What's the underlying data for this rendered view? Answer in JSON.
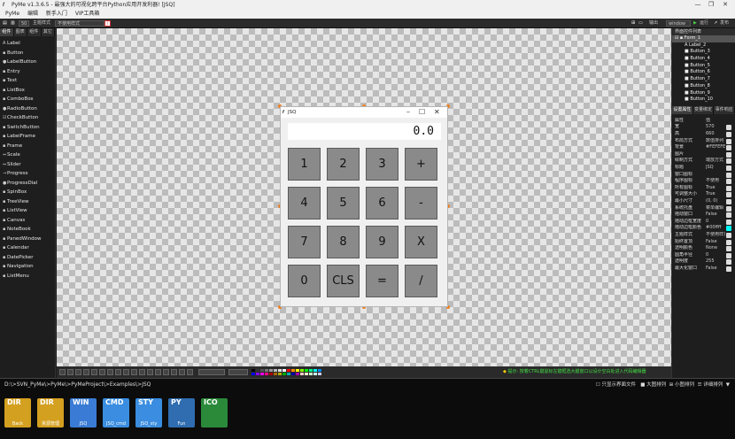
{
  "window": {
    "title": "PyMe v1.3.6.5 - 最强大的可视化跨平台Python应用开发利器! [JSQ]",
    "controls": [
      "—",
      "❐",
      "✕"
    ]
  },
  "menu": [
    "PyMe",
    "编辑",
    "新手入门",
    "VIP工具箱"
  ],
  "toolbar": {
    "zoom": "50",
    "theme_label": "主题样式",
    "style_select": "不使用样式",
    "output": "输出",
    "platform": "window",
    "run": "运行",
    "publish": "发布"
  },
  "palette": {
    "tabs": [
      "组件",
      "图表",
      "组件",
      "其它"
    ],
    "items": [
      {
        "icon": "A",
        "label": "Label"
      },
      {
        "icon": "▪",
        "label": "Button"
      },
      {
        "icon": "●",
        "label": "LabelButton"
      },
      {
        "icon": "▪",
        "label": "Entry"
      },
      {
        "icon": "▪",
        "label": "Text"
      },
      {
        "icon": "▪",
        "label": "ListBox"
      },
      {
        "icon": "▪",
        "label": "ComboBox"
      },
      {
        "icon": "●",
        "label": "RadioButton"
      },
      {
        "icon": "☑",
        "label": "CheckButton"
      },
      {
        "icon": "▪",
        "label": "SwitchButton"
      },
      {
        "icon": "▪",
        "label": "LabelFrame"
      },
      {
        "icon": "▪",
        "label": "Frame"
      },
      {
        "icon": "⇔",
        "label": "Scale"
      },
      {
        "icon": "⇔",
        "label": "Slider"
      },
      {
        "icon": "→",
        "label": "Progress"
      },
      {
        "icon": "●",
        "label": "ProgressDial"
      },
      {
        "icon": "▪",
        "label": "SpinBox"
      },
      {
        "icon": "▪",
        "label": "TreeView"
      },
      {
        "icon": "▪",
        "label": "ListView"
      },
      {
        "icon": "▪",
        "label": "Canvas"
      },
      {
        "icon": "▪",
        "label": "NoteBook"
      },
      {
        "icon": "▪",
        "label": "PanedWindow"
      },
      {
        "icon": "▪",
        "label": "Calendar"
      },
      {
        "icon": "▪",
        "label": "DatePicker"
      },
      {
        "icon": "▪",
        "label": "Navigation"
      },
      {
        "icon": "▪",
        "label": "ListMenu"
      }
    ]
  },
  "form": {
    "title": "JSQ",
    "display": "0.0",
    "keys": [
      "1",
      "2",
      "3",
      "+",
      "4",
      "5",
      "6",
      "-",
      "7",
      "8",
      "9",
      "X",
      "0",
      "CLS",
      "=",
      "/"
    ]
  },
  "tree": {
    "header": "界面控件列表",
    "root": "Form_1",
    "items": [
      "Label_2",
      "Button_3",
      "Button_4",
      "Button_5",
      "Button_6",
      "Button_7",
      "Button_8",
      "Button_9",
      "Button_10"
    ]
  },
  "props": {
    "tabs": [
      "设置属性",
      "变量绑定",
      "事件响应"
    ],
    "header": {
      "key": "属性",
      "value": "值"
    },
    "rows": [
      {
        "k": "宽",
        "v": "570"
      },
      {
        "k": "高",
        "v": "660"
      },
      {
        "k": "布局方式",
        "v": "数值排列"
      },
      {
        "k": "背景",
        "v": "#FEFEFE"
      },
      {
        "k": "图片",
        "v": ""
      },
      {
        "k": "绘制方式",
        "v": "端放方式"
      },
      {
        "k": "标题",
        "v": "JSQ"
      },
      {
        "k": "窗口图标",
        "v": ""
      },
      {
        "k": "程序图标",
        "v": "不使用"
      },
      {
        "k": "所有图标",
        "v": "True"
      },
      {
        "k": "可调整大小",
        "v": "True"
      },
      {
        "k": "最小尺寸",
        "v": "(0, 0)"
      },
      {
        "k": "系统托盘",
        "v": "菜单编辑"
      },
      {
        "k": "拖动窗口",
        "v": "False"
      },
      {
        "k": "拖动边框宽度",
        "v": "0"
      },
      {
        "k": "拖动边框颜色",
        "v": "#00ffff"
      },
      {
        "k": "主题样式",
        "v": "不使用样式"
      },
      {
        "k": "始终置顶",
        "v": "False"
      },
      {
        "k": "透明颜色",
        "v": "None"
      },
      {
        "k": "圆角半径",
        "v": "0"
      },
      {
        "k": "透明度",
        "v": "255"
      },
      {
        "k": "最大化窗口",
        "v": "False"
      }
    ]
  },
  "hint": "提示: 按着CTRL键鼠标左键框选大腿窗口以设计空白处进入代码编辑器",
  "path": {
    "text": "D:\\>SVN_PyMe\\>PyMe\\>PyMeProject\\>Examples\\>JSQ",
    "options": [
      "只显示界面文件",
      "大图排列",
      "小图排列",
      "详细排列"
    ]
  },
  "files": [
    {
      "top": "DIR",
      "sub": "Back",
      "color": "#d4a020"
    },
    {
      "top": "DIR",
      "sub": "资源管理",
      "color": "#d4a020"
    },
    {
      "top": "WIN",
      "sub": "JSQ",
      "color": "#3a7bd5"
    },
    {
      "top": "CMD",
      "sub": "JSQ_cmd",
      "color": "#3a8de0"
    },
    {
      "top": "STY",
      "sub": "JSQ_sty",
      "color": "#3a8de0"
    },
    {
      "top": "PY",
      "sub": "Fun",
      "color": "#2f6db0"
    },
    {
      "top": "ICO",
      "sub": "",
      "color": "#2a8a3a"
    }
  ],
  "colors": {
    "accent": "#f08020",
    "hint": "#44dd44",
    "key_bg": "#8a8a8a"
  }
}
